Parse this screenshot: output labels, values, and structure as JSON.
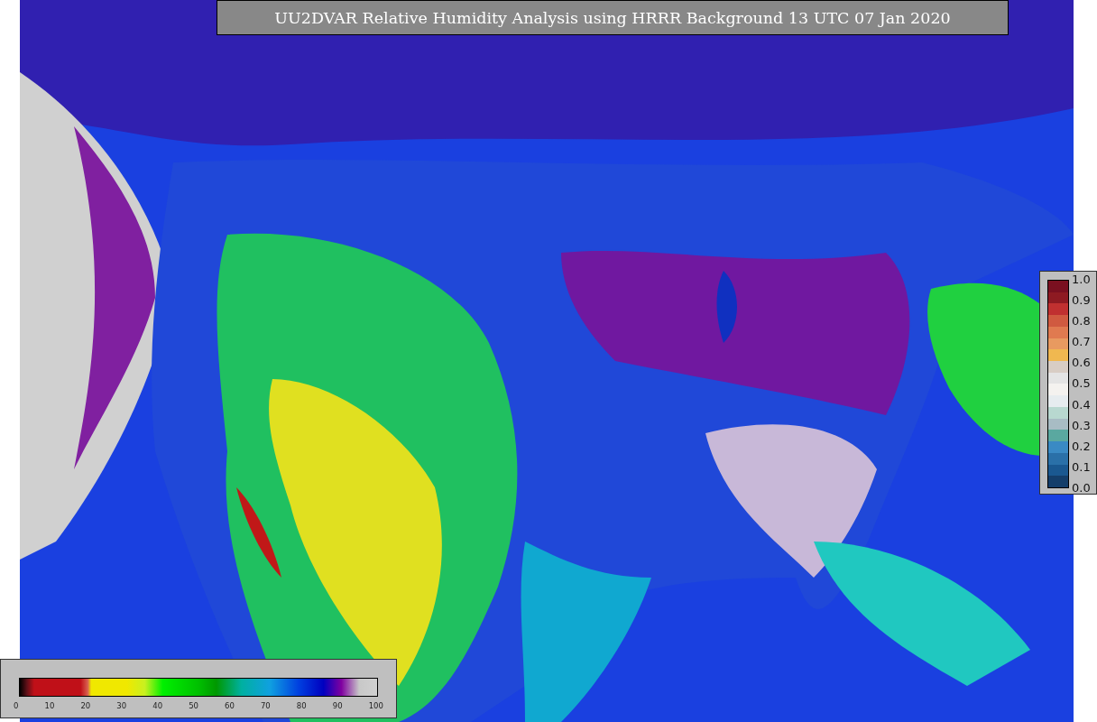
{
  "title": "UU2DVAR Relative Humidity Analysis using HRRR Background 13 UTC 07 Jan 2020",
  "innovation_colorbar": {
    "ticks": [
      "1.0",
      "0.9",
      "0.8",
      "0.7",
      "0.6",
      "0.5",
      "0.4",
      "0.3",
      "0.2",
      "0.1",
      "0.0"
    ]
  },
  "humidity_colorbar": {
    "ticks": [
      "0",
      "10",
      "20",
      "30",
      "40",
      "50",
      "60",
      "70",
      "80",
      "90",
      "100"
    ]
  }
}
